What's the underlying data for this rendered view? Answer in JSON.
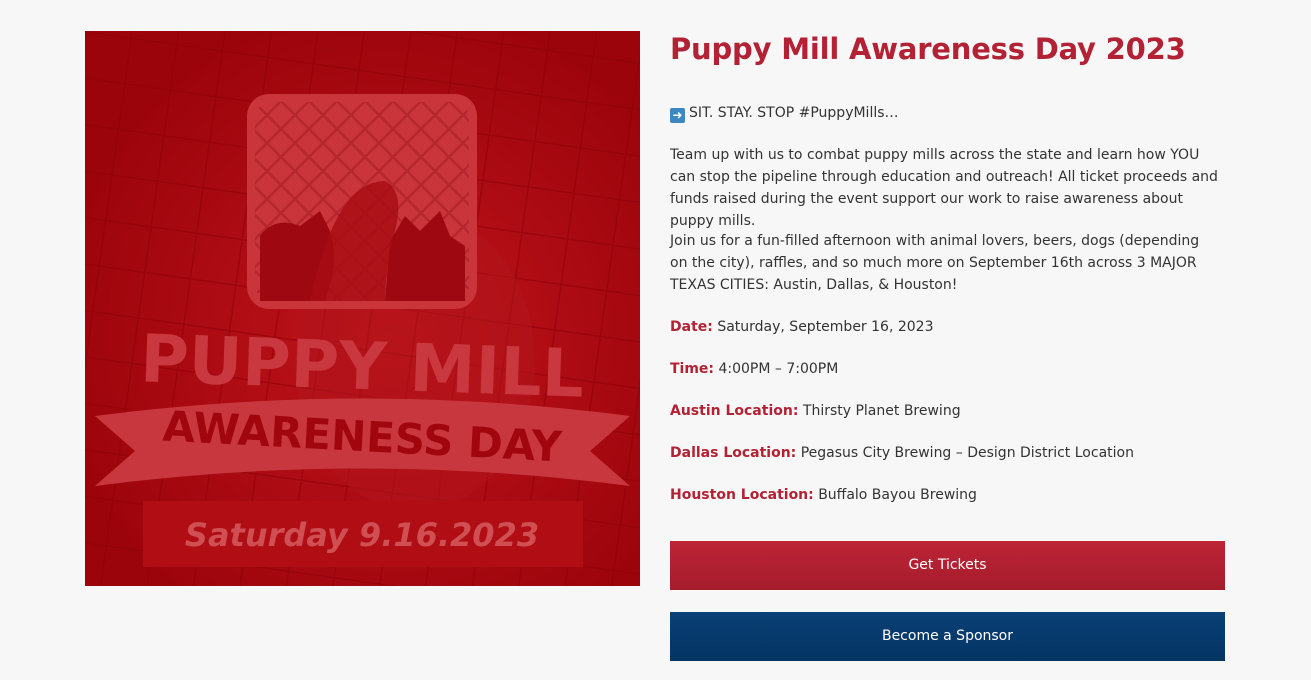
{
  "promo_image": {
    "title_line_1": "PUPPY MILL",
    "title_line_2": "AWARENESS DAY",
    "date_banner": "Saturday 9.16.2023",
    "colors": {
      "background": "#a5050d",
      "overlay_text": "#c83a40",
      "date_box": "#b00d14"
    }
  },
  "event": {
    "title": "Puppy Mill Awareness Day 2023",
    "intro_icon": "right-arrow-icon",
    "intro_text": "SIT. STAY. STOP #PuppyMills…",
    "paragraph_1": "Team up with us to combat puppy mills across the state and learn how YOU can stop the pipeline through education and outreach! All ticket proceeds and funds raised during the event support our work to raise awareness about puppy mills.",
    "paragraph_2": "Join us for a fun-filled afternoon with animal lovers, beers, dogs (depending on the city), raffles, and so much more on September 16th across 3 MAJOR TEXAS CITIES: Austin, Dallas, & Houston!",
    "details": {
      "date_label": "Date:",
      "date_value": "Saturday, September 16, 2023",
      "time_label": "Time:",
      "time_value": "4:00PM – 7:00PM",
      "austin_label": "Austin Location:",
      "austin_value": "Thirsty Planet Brewing",
      "dallas_label": "Dallas Location:",
      "dallas_value": "Pegasus City Brewing – Design District Location",
      "houston_label": "Houston Location:",
      "houston_value": "Buffalo Bayou Brewing"
    }
  },
  "buttons": {
    "tickets_label": "Get Tickets",
    "sponsor_label": "Become a Sponsor"
  },
  "colors": {
    "accent_red": "#b22234",
    "button_red": "#a51c2d",
    "button_blue": "#033563",
    "page_background": "#f7f7f7"
  }
}
